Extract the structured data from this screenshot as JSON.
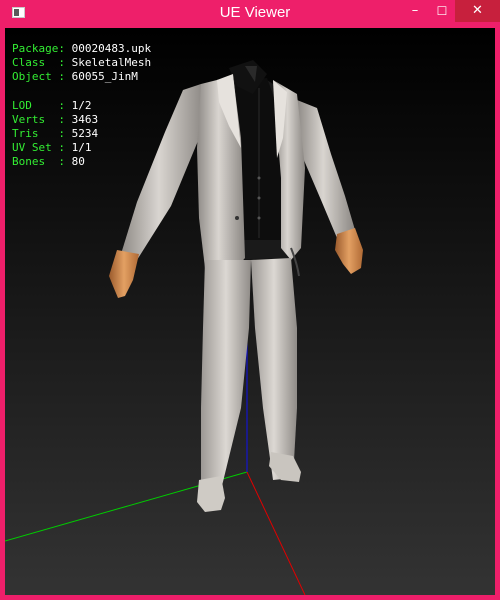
{
  "window": {
    "title": "UE Viewer",
    "controls": {
      "minimize": "–",
      "maximize": "☐",
      "close": "✕"
    }
  },
  "info": {
    "package": {
      "label": "Package:",
      "value": "00020483.upk"
    },
    "class": {
      "label": "Class  :",
      "value": "SkeletalMesh"
    },
    "object": {
      "label": "Object :",
      "value": "60055_JinM"
    },
    "lod": {
      "label": "LOD    :",
      "value": "1/2"
    },
    "verts": {
      "label": "Verts  :",
      "value": "3463"
    },
    "tris": {
      "label": "Tris   :",
      "value": "5234"
    },
    "uvset": {
      "label": "UV Set :",
      "value": "1/1"
    },
    "bones": {
      "label": "Bones  :",
      "value": "80"
    }
  },
  "colors": {
    "titlebar": "#ee1f6a",
    "close_button": "#c7203d",
    "label_text": "#33ee33",
    "value_text": "#ffffff",
    "axis_x": "#e00000",
    "axis_y": "#00cc00",
    "axis_z": "#1010ee"
  }
}
